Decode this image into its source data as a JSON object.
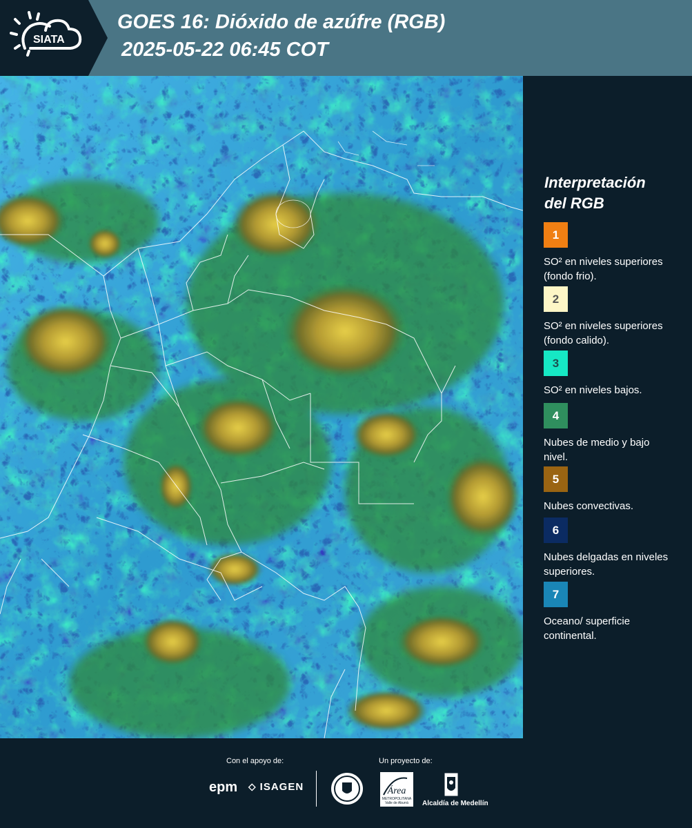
{
  "header": {
    "logo_text": "SIATA",
    "title_line1": "GOES 16: Dióxido de azúfre (RGB)",
    "title_line2": "2025-05-22 06:45 COT"
  },
  "legend": {
    "title_line1": "Interpretación",
    "title_line2": "del RGB",
    "items": [
      {
        "number": "1",
        "color": "#f07f13",
        "number_color": "#ffffff",
        "label": "SO² en niveles superiores (fondo frio)."
      },
      {
        "number": "2",
        "color": "#fdf6c6",
        "number_color": "#555555",
        "label": "SO² en niveles superiores (fondo calido)."
      },
      {
        "number": "3",
        "color": "#16e8c4",
        "number_color": "#1d4f4f",
        "label": "SO² en niveles bajos."
      },
      {
        "number": "4",
        "color": "#2f8f5e",
        "number_color": "#ffffff",
        "label": "Nubes de medio y bajo nivel."
      },
      {
        "number": "5",
        "color": "#9a6412",
        "number_color": "#ffffff",
        "label": "Nubes convectivas."
      },
      {
        "number": "6",
        "color": "#0b2b62",
        "number_color": "#ffffff",
        "label": "Nubes delgadas en niveles superiores."
      },
      {
        "number": "7",
        "color": "#1a86b6",
        "number_color": "#ffffff",
        "label": "Oceano/ superficie continental."
      }
    ]
  },
  "footer": {
    "support_label": "Con el apoyo de:",
    "project_label": "Un proyecto de:",
    "sponsor1": "epm",
    "sponsor2": "ISAGEN",
    "partner1": "Área",
    "partner1_sub": "METROPOLITANA",
    "partner1_sub2": "Valle de Aburrá",
    "partner2": "Alcaldía de Medellín"
  }
}
